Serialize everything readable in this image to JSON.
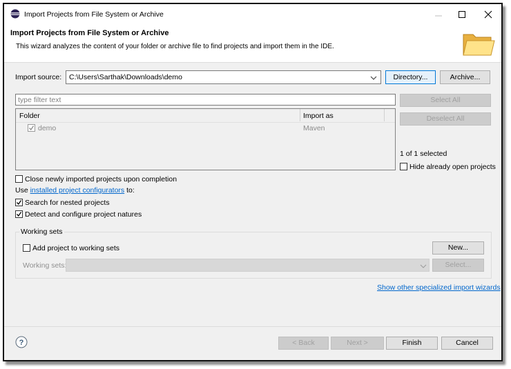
{
  "window": {
    "title": "Import Projects from File System or Archive",
    "controls": {
      "minimize": "minimize-icon",
      "maximize": "maximize-icon",
      "close": "close-icon"
    }
  },
  "header": {
    "title": "Import Projects from File System or Archive",
    "description": "This wizard analyzes the content of your folder or archive file to find projects and import them in the IDE."
  },
  "import_source": {
    "label": "Import source:",
    "value": "C:\\Users\\Sarthak\\Downloads\\demo",
    "directory_button": "Directory...",
    "archive_button": "Archive..."
  },
  "filter": {
    "placeholder": "type filter text"
  },
  "table": {
    "columns": [
      "Folder",
      "Import as"
    ],
    "rows": [
      {
        "folder": "demo",
        "import_as": "Maven",
        "checked": true
      }
    ]
  },
  "side": {
    "select_all": "Select All",
    "deselect_all": "Deselect All",
    "selected_count": "1 of 1 selected",
    "hide_open_label": "Hide already open projects"
  },
  "options": {
    "close_projects_label": "Close newly imported projects upon completion",
    "use_prefix": "Use ",
    "configurators_link": "installed project configurators",
    "use_suffix": " to:",
    "search_nested_label": "Search for nested projects",
    "detect_natures_label": "Detect and configure project natures"
  },
  "working_sets": {
    "group_label": "Working sets",
    "add_label": "Add project to working sets",
    "new_button": "New...",
    "sets_label": "Working sets:",
    "select_button": "Select..."
  },
  "links": {
    "other_wizards": "Show other specialized import wizards"
  },
  "footer": {
    "back": "< Back",
    "next": "Next >",
    "finish": "Finish",
    "cancel": "Cancel"
  },
  "colors": {
    "accent": "#0078d7",
    "link": "#0066cc",
    "dialog_bg": "#f0f0f0"
  }
}
